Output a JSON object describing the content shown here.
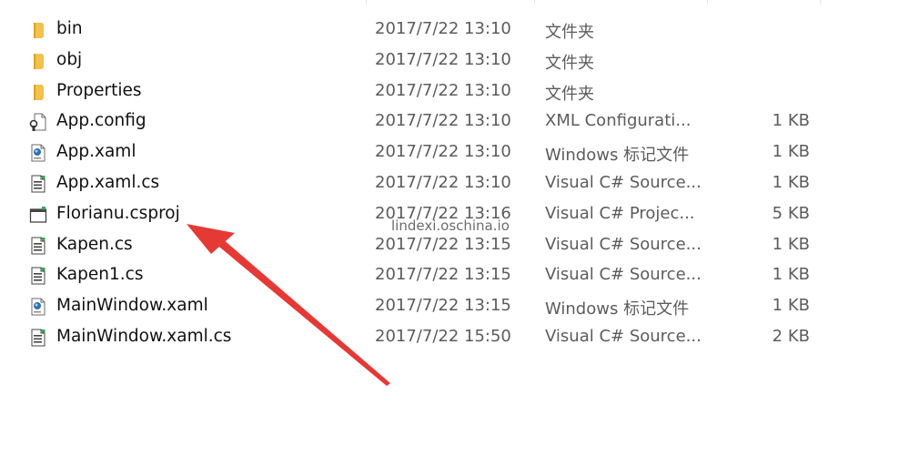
{
  "files": [
    {
      "name": "bin",
      "date": "2017/7/22 13:10",
      "type": "文件夹",
      "size": "",
      "icon": "folder-icon"
    },
    {
      "name": "obj",
      "date": "2017/7/22 13:10",
      "type": "文件夹",
      "size": "",
      "icon": "folder-icon"
    },
    {
      "name": "Properties",
      "date": "2017/7/22 13:10",
      "type": "文件夹",
      "size": "",
      "icon": "folder-icon"
    },
    {
      "name": "App.config",
      "date": "2017/7/22 13:10",
      "type": "XML Configurati...",
      "size": "1 KB",
      "icon": "config-file-icon"
    },
    {
      "name": "App.xaml",
      "date": "2017/7/22 13:10",
      "type": "Windows 标记文件",
      "size": "1 KB",
      "icon": "xaml-file-icon"
    },
    {
      "name": "App.xaml.cs",
      "date": "2017/7/22 13:10",
      "type": "Visual C# Source...",
      "size": "1 KB",
      "icon": "csharp-file-icon"
    },
    {
      "name": "Florianu.csproj",
      "date": "2017/7/22 13:16",
      "type": "Visual C# Projec...",
      "size": "5 KB",
      "icon": "csproj-file-icon"
    },
    {
      "name": "Kapen.cs",
      "date": "2017/7/22 13:15",
      "type": "Visual C# Source...",
      "size": "1 KB",
      "icon": "csharp-file-icon"
    },
    {
      "name": "Kapen1.cs",
      "date": "2017/7/22 13:15",
      "type": "Visual C# Source...",
      "size": "1 KB",
      "icon": "csharp-file-icon"
    },
    {
      "name": "MainWindow.xaml",
      "date": "2017/7/22 13:15",
      "type": "Windows 标记文件",
      "size": "1 KB",
      "icon": "xaml-file-icon"
    },
    {
      "name": "MainWindow.xaml.cs",
      "date": "2017/7/22 15:50",
      "type": "Visual C# Source...",
      "size": "2 KB",
      "icon": "csharp-file-icon"
    }
  ],
  "watermark": "lindexi.oschina.io",
  "colors": {
    "folder": "#f2c14e",
    "arrow": "#e53935",
    "text_secondary": "#5c5c5c"
  }
}
